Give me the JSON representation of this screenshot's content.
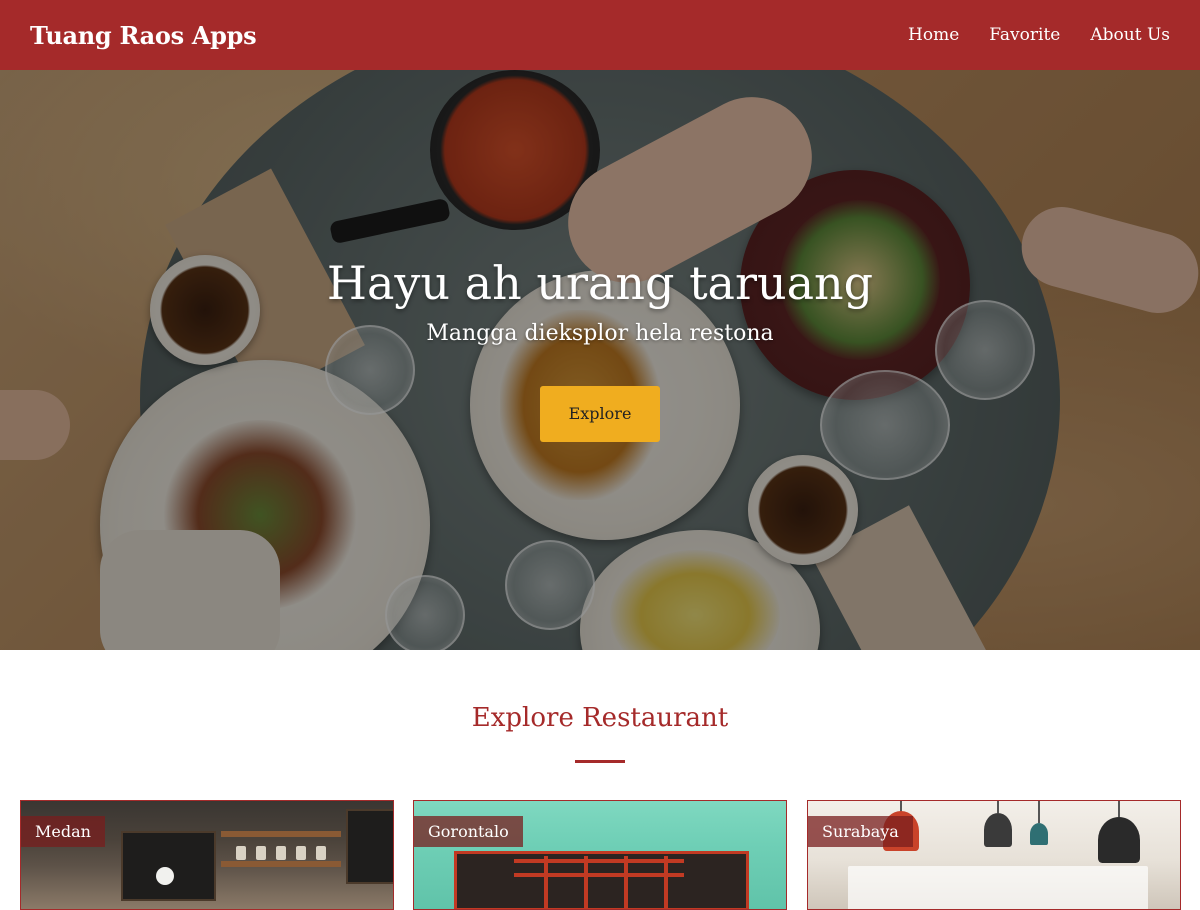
{
  "header": {
    "brand": "Tuang Raos Apps",
    "nav": [
      {
        "label": "Home"
      },
      {
        "label": "Favorite"
      },
      {
        "label": "About Us"
      }
    ]
  },
  "hero": {
    "title": "Hayu ah urang taruang",
    "subtitle": "Mangga dieksplor hela restona",
    "button_label": "Explore"
  },
  "section": {
    "title": "Explore Restaurant"
  },
  "restaurants": [
    {
      "city": "Medan"
    },
    {
      "city": "Gorontalo"
    },
    {
      "city": "Surabaya"
    }
  ],
  "colors": {
    "primary": "#a52a2a",
    "accent": "#f0ad1f",
    "background": "#ffffff"
  }
}
